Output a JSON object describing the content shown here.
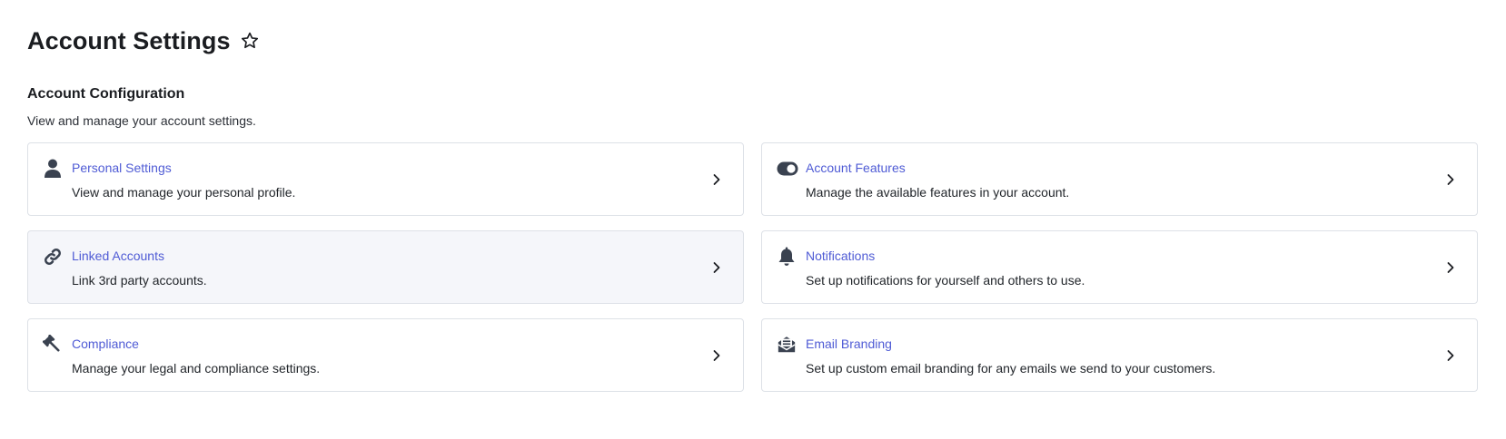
{
  "header": {
    "title": "Account Settings",
    "favorite_icon": "star-outline-icon"
  },
  "section": {
    "title": "Account Configuration",
    "description": "View and manage your account settings."
  },
  "colors": {
    "link": "#4f5bd5",
    "icon": "#3a4250",
    "card_border": "#dde1e7",
    "card_hover_bg": "#f5f6fa"
  },
  "cards": [
    {
      "title": "Personal Settings",
      "description": "View and manage your personal profile.",
      "icon": "user-icon"
    },
    {
      "title": "Account Features",
      "description": "Manage the available features in your account.",
      "icon": "toggle-icon"
    },
    {
      "title": "Linked Accounts",
      "description": "Link 3rd party accounts.",
      "icon": "link-icon",
      "hovered": true
    },
    {
      "title": "Notifications",
      "description": "Set up notifications for yourself and others to use.",
      "icon": "bell-icon"
    },
    {
      "title": "Compliance",
      "description": "Manage your legal and compliance settings.",
      "icon": "gavel-icon"
    },
    {
      "title": "Email Branding",
      "description": "Set up custom email branding for any emails we send to your customers.",
      "icon": "email-branding-icon"
    }
  ]
}
